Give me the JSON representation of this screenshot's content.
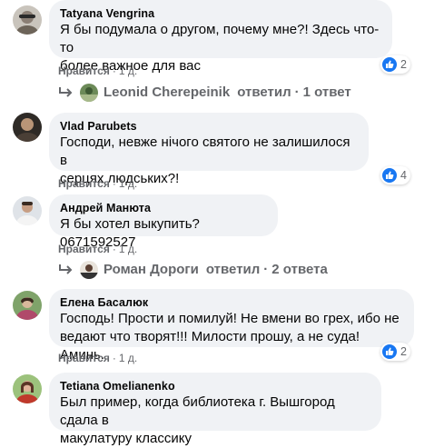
{
  "comments": [
    {
      "author": "Tatyana Vengrina",
      "text": "Я бы подумала о другом, почему мне?! Здесь что-то\nболее важное для вас",
      "like_label": "Нравится",
      "time": "1 д.",
      "reactions": "2",
      "replies": {
        "author": "Leonid Cherepeinik",
        "verb": "ответил",
        "count": "1 ответ"
      }
    },
    {
      "author": "Vlad Parubets",
      "text": "Господи, невже нічого святого не залишилося в\nсерцях людських?!",
      "like_label": "Нравится",
      "time": "1 д.",
      "reactions": "4"
    },
    {
      "author": "Андрей Манюта",
      "text": "Я бы хотел выкупить?0671592527",
      "like_label": "Нравится",
      "time": "1 д.",
      "replies": {
        "author": "Роман Дороги",
        "verb": "ответил",
        "count": "2 ответа"
      }
    },
    {
      "author": "Елена Басалюк",
      "text": "Господь! Прости и помилуй! Не вмени во грех, ибо не\nведают что творят!!! Милости прошу, а не суда! Аминь.",
      "like_label": "Нравится",
      "time": "1 д.",
      "reactions": "2"
    },
    {
      "author": "Tetiana Omelianenko",
      "text": "Был пример, когда библиотека г. Вышгород сдала в\nмакулатуру классику"
    }
  ],
  "colors": {
    "bubble": "#f0f2f5",
    "like_blue": "#1877f2",
    "muted": "#65676b"
  },
  "icons": {
    "reaction": "thumbs-up-icon",
    "reply": "reply-arrow-icon"
  }
}
